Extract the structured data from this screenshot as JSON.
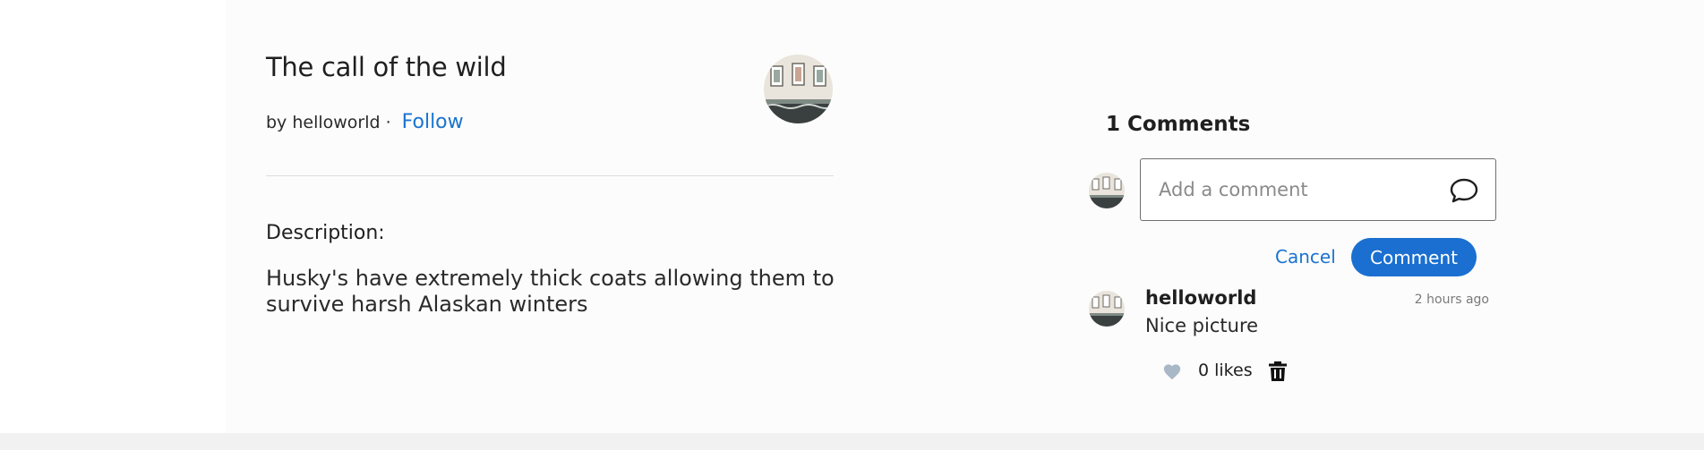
{
  "post": {
    "title": "The call of the wild",
    "by_prefix": "by helloworld",
    "dot": "·",
    "follow_label": "Follow",
    "author_avatar_icon": "avatar-photo",
    "description_label": "Description:",
    "description_text": "Husky's have extremely thick coats allowing them to survive harsh Alaskan winters"
  },
  "comments": {
    "heading": "1 Comments",
    "input_placeholder": "Add a comment",
    "input_value": "",
    "chat_icon": "chat-bubble-icon",
    "cancel_label": "Cancel",
    "submit_label": "Comment",
    "items": [
      {
        "author": "helloworld",
        "time": "2 hours ago",
        "text": "Nice picture",
        "likes": "0 likes",
        "like_icon": "heart-icon",
        "delete_icon": "trash-icon"
      }
    ]
  },
  "colors": {
    "accent": "#1a6fd0",
    "link": "#1a73cf",
    "heart": "#a9b8c6",
    "background": "#fcfcfc",
    "footer": "#f1f1f1"
  }
}
